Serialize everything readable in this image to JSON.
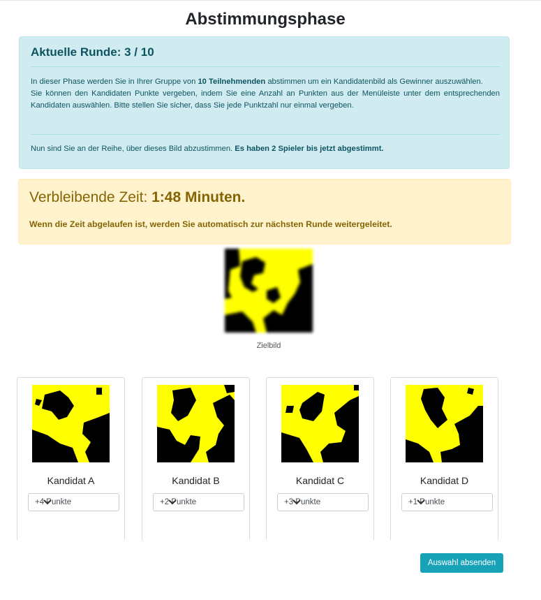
{
  "page": {
    "title": "Abstimmungsphase"
  },
  "info": {
    "round_label": "Aktuelle Runde: 3 / 10",
    "p1_a": "In dieser Phase werden Sie in Ihrer Gruppe von ",
    "p1_b": "10 Teilnehmenden",
    "p1_c": " abstimmen um ein Kandidatenbild als Gewinner auszuwählen.",
    "p2": "Sie können den Kandidaten Punkte vergeben, indem Sie eine Anzahl an Punkten aus der Menüleiste unter dem entsprechenden Kandidaten auswählen. Bitte stellen Sie sicher, dass Sie jede Punktzahl nur einmal vergeben.",
    "p3_a": "Nun sind Sie an der Reihe, über dieses Bild abzustimmen. ",
    "p3_b": "Es haben 2 Spieler bis jetzt abgestimmt."
  },
  "timer": {
    "prefix": "Verbleibende Zeit: ",
    "value": "1:48 Minuten.",
    "note": "Wenn die Zeit abgelaufen ist, werden Sie automatisch zur nächsten Runde weitergeleitet."
  },
  "target": {
    "label": "Zielbild"
  },
  "candidates": [
    {
      "name": "Kandidat A",
      "selected": "+4 Punkte"
    },
    {
      "name": "Kandidat B",
      "selected": "+2 Punkte"
    },
    {
      "name": "Kandidat C",
      "selected": "+3 Punkte"
    },
    {
      "name": "Kandidat D",
      "selected": "+1 Punkte"
    }
  ],
  "submit": {
    "label": "Auswahl absenden"
  },
  "colors": {
    "yellow": "#ffff00",
    "black": "#000000",
    "accent": "#17a2b8"
  }
}
